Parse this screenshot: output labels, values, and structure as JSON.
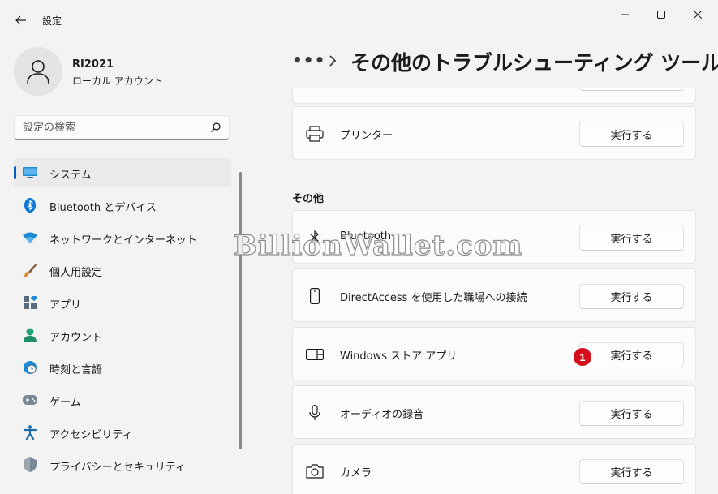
{
  "window": {
    "app_title": "設定",
    "controls": {
      "minimize": "minimize",
      "maximize": "maximize",
      "close": "close"
    }
  },
  "user": {
    "name": "RI2021",
    "account_type": "ローカル アカウント"
  },
  "search": {
    "placeholder": "設定の検索"
  },
  "sidebar": {
    "items": [
      {
        "label": "システム",
        "icon": "monitor-icon",
        "selected": true
      },
      {
        "label": "Bluetooth とデバイス",
        "icon": "bluetooth-icon"
      },
      {
        "label": "ネットワークとインターネット",
        "icon": "wifi-icon"
      },
      {
        "label": "個人用設定",
        "icon": "brush-icon"
      },
      {
        "label": "アプリ",
        "icon": "apps-icon"
      },
      {
        "label": "アカウント",
        "icon": "person-icon"
      },
      {
        "label": "時刻と言語",
        "icon": "clock-globe-icon"
      },
      {
        "label": "ゲーム",
        "icon": "gamepad-icon"
      },
      {
        "label": "アクセシビリティ",
        "icon": "accessibility-icon"
      },
      {
        "label": "プライバシーとセキュリティ",
        "icon": "shield-icon"
      }
    ]
  },
  "breadcrumb": {
    "ellipsis": "•••",
    "title": "その他のトラブルシューティング ツール"
  },
  "content": {
    "top_cards": [
      {
        "label": "プリンター",
        "icon": "printer-icon",
        "button": "実行する"
      }
    ],
    "section_other": "その他",
    "other_cards": [
      {
        "label": "Bluetooth",
        "icon": "bluetooth-icon",
        "button": "実行する"
      },
      {
        "label": "DirectAccess を使用した職場への接続",
        "icon": "phone-device-icon",
        "button": "実行する"
      },
      {
        "label": "Windows ストア アプリ",
        "icon": "store-app-icon",
        "button": "実行する",
        "annotation": "1"
      },
      {
        "label": "オーディオの録音",
        "icon": "microphone-icon",
        "button": "実行する"
      },
      {
        "label": "カメラ",
        "icon": "camera-icon",
        "button": "実行する"
      }
    ]
  },
  "watermark": "BillionWallet.com",
  "colors": {
    "accent": "#005fb8",
    "annotation": "#d40f1b"
  }
}
